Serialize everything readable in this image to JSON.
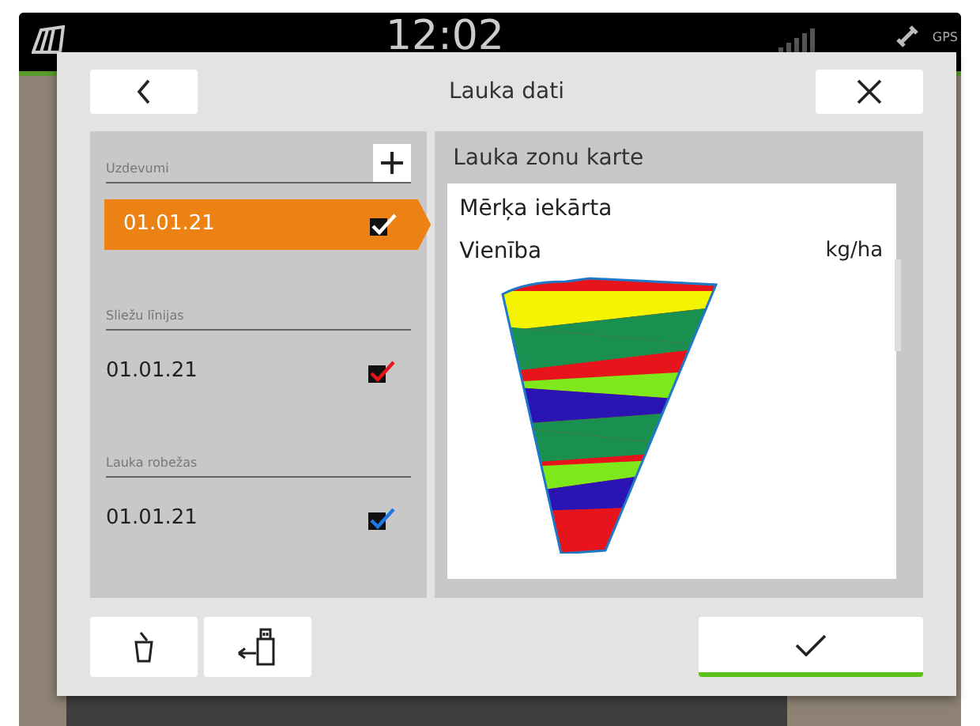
{
  "status_bar": {
    "clock": "12:02",
    "gps_label": "GPS"
  },
  "dialog": {
    "title": "Lauka dati",
    "sections": [
      {
        "label": "Uzdevumi",
        "can_add": true,
        "items": [
          {
            "date": "01.01.21",
            "selected": true,
            "checked": true,
            "color": "#ffffff"
          }
        ]
      },
      {
        "label": "Sliežu līnijas",
        "can_add": false,
        "items": [
          {
            "date": "01.01.21",
            "selected": false,
            "checked": true,
            "color": "#e8141c"
          }
        ]
      },
      {
        "label": "Lauka robežas",
        "can_add": false,
        "items": [
          {
            "date": "01.01.21",
            "selected": false,
            "checked": true,
            "color": "#1e78e6"
          }
        ]
      }
    ],
    "detail": {
      "heading": "Lauka zonu karte",
      "card_title": "Mērķa iekārta",
      "unit_label": "Vienība",
      "unit_value": "kg/ha"
    }
  }
}
